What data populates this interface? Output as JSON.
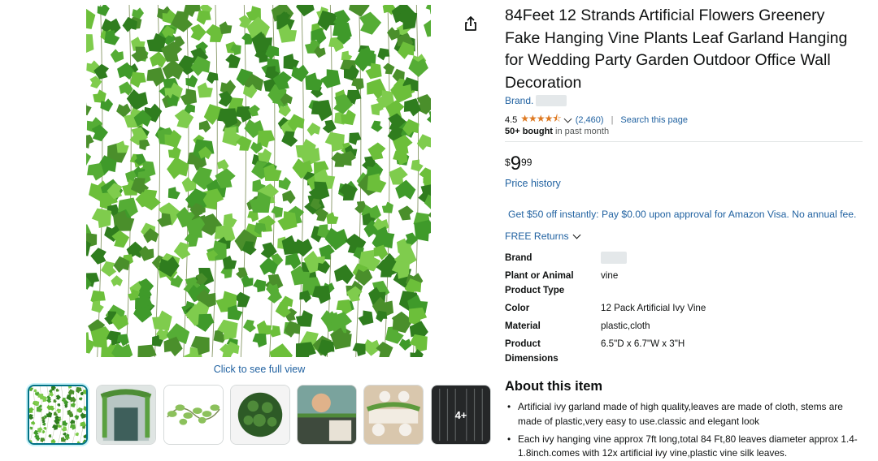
{
  "product": {
    "title": "84Feet 12 Strands Artificial Flowers Greenery Fake Hanging Vine Plants Leaf Garland Hanging for Wedding Party Garden Outdoor Office Wall Decoration",
    "brand_prefix": "Brand.",
    "rating_value": "4.5",
    "stars": "★★★★⯪",
    "rating_count": "(2,460)",
    "search_page": "Search this page",
    "bought_bold": "50+ bought",
    "bought_rest": " in past month",
    "price_symbol": "$",
    "price_whole": "9",
    "price_fraction": "99",
    "price_history": "Price history",
    "promo": "Get $50 off instantly: Pay $0.00 upon approval for Amazon Visa. No annual fee.",
    "returns": "FREE Returns"
  },
  "specs": [
    {
      "label": "Brand",
      "value": ""
    },
    {
      "label": "Plant or Animal Product Type",
      "value": "vine"
    },
    {
      "label": "Color",
      "value": "12 Pack Artificial Ivy Vine"
    },
    {
      "label": "Material",
      "value": "plastic,cloth"
    },
    {
      "label": "Product Dimensions",
      "value": "6.5\"D x 6.7\"W x 3\"H"
    }
  ],
  "about": {
    "heading": "About this item",
    "items": [
      "Artificial ivy garland made of high quality,leaves are made of cloth, stems are made of plastic,very easy to use.classic and elegant look",
      "Each ivy hanging vine approx 7ft long,total 84 Ft,80 leaves diameter approx 1.4-1.8inch.comes with 12x artificial ivy vine,plastic vine silk leaves."
    ]
  },
  "gallery": {
    "full_view": "Click to see full view",
    "more_label": "4+"
  },
  "colors": {
    "link": "#2162a1",
    "star": "#de7921",
    "leaf_dark": "#2f7d1e",
    "leaf_light": "#6cbf3a",
    "selected_border": "#007185"
  }
}
